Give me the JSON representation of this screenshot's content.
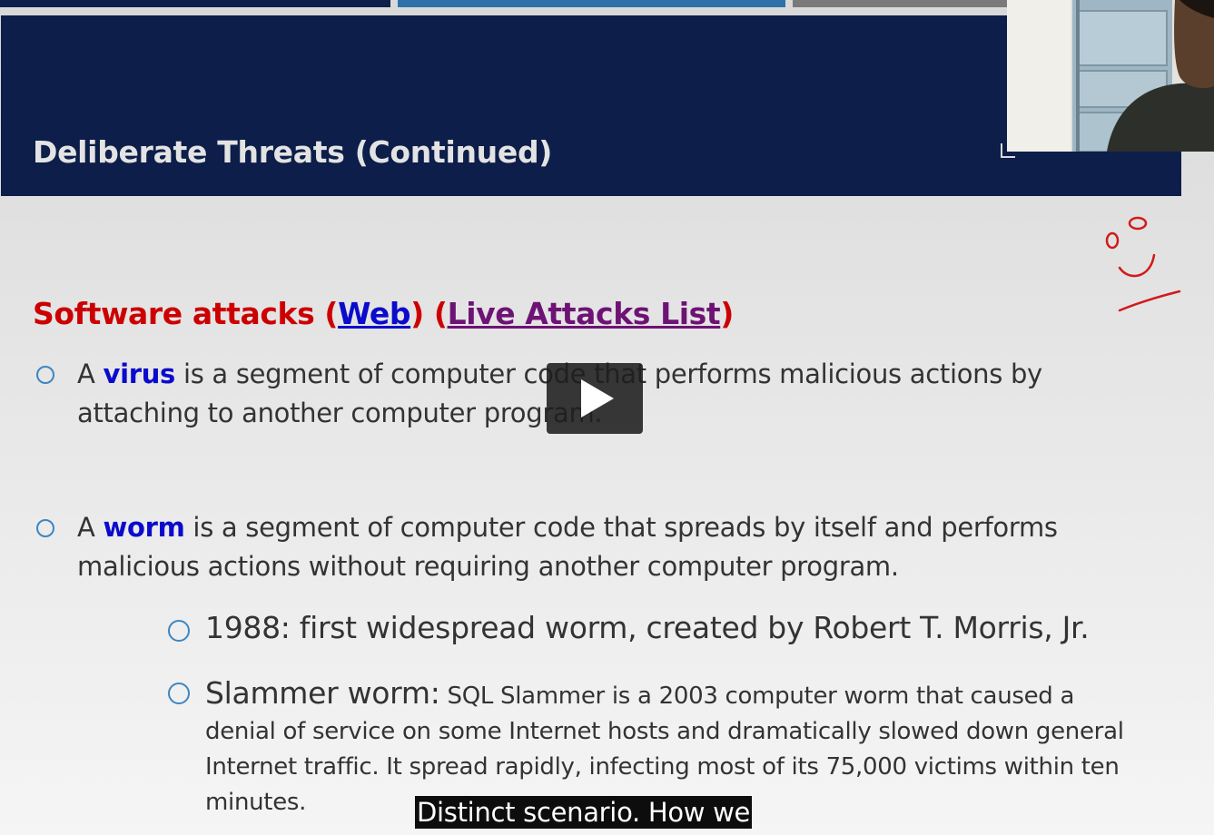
{
  "slide": {
    "title": "Deliberate Threats (Continued)",
    "heading": {
      "prefix": "Software attacks (",
      "link_web": "Web",
      "middle": ") (",
      "link_live": "Live Attacks List",
      "suffix": ")"
    },
    "bullets": [
      {
        "pre": "A ",
        "term": "virus",
        "post": " is a segment of computer code that performs malicious actions by attaching to another computer program."
      },
      {
        "pre": "A ",
        "term": "worm",
        "post": " is a segment of computer code that spreads by itself and performs malicious actions without requiring another computer program."
      }
    ],
    "sub_bullets": [
      {
        "text": "1988: first widespread worm, created by Robert T. Morris, Jr."
      },
      {
        "lead": "Slammer worm:",
        "text": " SQL Slammer is a 2003 computer worm that caused a denial of service on some Internet hosts and dramatically slowed down general Internet traffic. It spread rapidly, infecting most of its 75,000 victims within ten minutes."
      }
    ]
  },
  "player": {
    "play_icon": "play-icon",
    "caption": "Distinct scenario. How we"
  },
  "colors": {
    "title_bar": "#0c1e49",
    "heading_red": "#cc0000",
    "link_blue": "#0b0bcc",
    "link_purple": "#6e1275",
    "bullet_ring": "#3d86c2",
    "annotation_ink": "#d11a1a"
  }
}
